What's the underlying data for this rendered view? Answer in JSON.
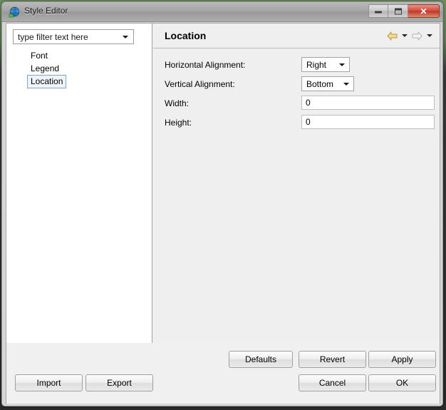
{
  "window": {
    "title": "Style Editor",
    "icon": "globe-icon",
    "controls": {
      "minimize": "minimize-button",
      "maximize": "maximize-button",
      "close": "close-button",
      "close_glyph": "✕"
    }
  },
  "sidebar": {
    "filter": {
      "value": "type filter text here",
      "placeholder": "type filter text here"
    },
    "items": [
      {
        "label": "Font",
        "selected": false
      },
      {
        "label": "Legend",
        "selected": false
      },
      {
        "label": "Location",
        "selected": true
      }
    ]
  },
  "panel": {
    "title": "Location",
    "nav": {
      "back": "back-arrow-icon",
      "back_menu": "back-dropdown-icon",
      "forward": "forward-arrow-icon",
      "forward_menu": "forward-dropdown-icon"
    },
    "fields": [
      {
        "label": "Horizontal Alignment:",
        "type": "dropdown",
        "value": "Right",
        "name": "horizontal-alignment"
      },
      {
        "label": "Vertical Alignment:",
        "type": "dropdown",
        "value": "Bottom",
        "name": "vertical-alignment"
      },
      {
        "label": "Width:",
        "type": "text",
        "value": "0",
        "name": "width"
      },
      {
        "label": "Height:",
        "type": "text",
        "value": "0",
        "name": "height"
      }
    ]
  },
  "buttons": {
    "import": "Import",
    "export": "Export",
    "defaults": "Defaults",
    "revert": "Revert",
    "apply": "Apply",
    "cancel": "Cancel",
    "ok": "OK"
  },
  "colors": {
    "back_arrow": "#f2d48a",
    "forward_arrow": "#c8c8c8",
    "selection_fill": "#eef4fc",
    "selection_border": "#8aa4c4",
    "close_button": "#cf4b37",
    "panel_bg": "#efefef",
    "sidebar_bg": "#ffffff"
  }
}
